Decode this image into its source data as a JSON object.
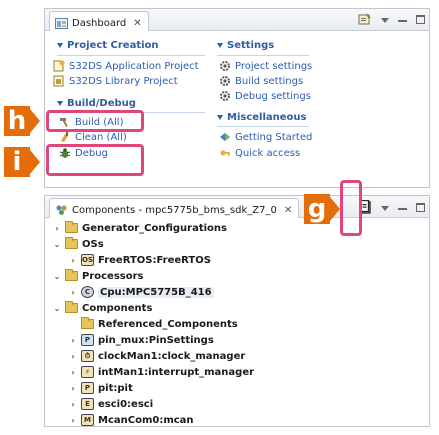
{
  "dashboard": {
    "tab_title": "Dashboard",
    "tab_close": "✕",
    "sections": {
      "project_creation": {
        "title": "Project Creation",
        "items": [
          "S32DS Application Project",
          "S32DS Library Project"
        ]
      },
      "build_debug": {
        "title": "Build/Debug",
        "items": [
          "Build  (All)",
          "Clean  (All)",
          "Debug"
        ]
      },
      "settings": {
        "title": "Settings",
        "items": [
          "Project settings",
          "Build settings",
          "Debug settings"
        ]
      },
      "miscellaneous": {
        "title": "Miscellaneous",
        "items": [
          "Getting Started",
          "Quick access"
        ]
      }
    }
  },
  "components": {
    "tab_title": "Components - mpc5775b_bms_sdk_Z7_0",
    "tab_close": "✕",
    "tree": [
      {
        "label": "Generator_Configurations",
        "expander": "›",
        "icon": "folder"
      },
      {
        "label": "OSs",
        "expander": "⌄",
        "icon": "folder"
      },
      {
        "label": "FreeRTOS:FreeRTOS",
        "expander": "›",
        "icon": "component-icon",
        "glyph": "OS"
      },
      {
        "label": "Processors",
        "expander": "⌄",
        "icon": "folder"
      },
      {
        "label": "Cpu:MPC5775B_416",
        "expander": "›",
        "icon": "cpu-icon",
        "glyph": "C"
      },
      {
        "label": "Components",
        "expander": "⌄",
        "icon": "folder"
      },
      {
        "label": "Referenced_Components",
        "expander": "",
        "icon": "folder"
      },
      {
        "label": "pin_mux:PinSettings",
        "expander": "›",
        "icon": "component-icon",
        "glyph": "P"
      },
      {
        "label": "clockMan1:clock_manager",
        "expander": "›",
        "icon": "component-icon",
        "glyph": "⏱"
      },
      {
        "label": "intMan1:interrupt_manager",
        "expander": "›",
        "icon": "component-icon",
        "glyph": "⚡"
      },
      {
        "label": "pit:pit",
        "expander": "›",
        "icon": "component-icon",
        "glyph": "P"
      },
      {
        "label": "esci0:esci",
        "expander": "›",
        "icon": "component-icon",
        "glyph": "E"
      },
      {
        "label": "McanCom0:mcan",
        "expander": "›",
        "icon": "component-icon",
        "glyph": "M"
      }
    ]
  },
  "annotations": {
    "h": "h",
    "i": "i",
    "g": "g"
  },
  "colors": {
    "accent_link": "#2a5db0",
    "section_header": "#2f5da0",
    "highlight_box": "#e0457b",
    "badge": "#e46c0a"
  }
}
